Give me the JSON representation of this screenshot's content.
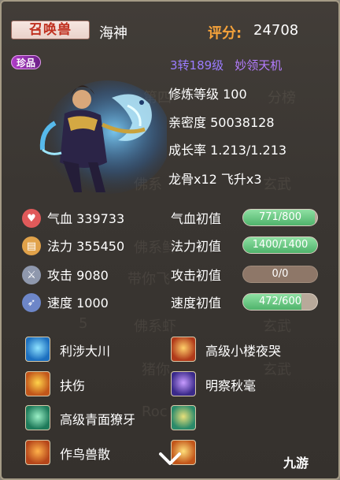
{
  "header": {
    "name_tag": "召唤兽",
    "pet_name": "海神",
    "score_label": "评分:",
    "score_value": "24708"
  },
  "portrait": {
    "rarity": "珍品",
    "reincarnation": "3转189级",
    "title": "妙领天机"
  },
  "info": {
    "cultivation": "修炼等级 100",
    "intimacy": "亲密度 50038128",
    "growth": "成长率 1.213/1.213",
    "items": "龙骨x12   飞升x3"
  },
  "stats": [
    {
      "label": "气血 339733",
      "init_label": "气血初值",
      "bar_text": "771/800",
      "fill": 0.964,
      "icon": "heart-icon",
      "color": "#e05a5a"
    },
    {
      "label": "法力 355450",
      "init_label": "法力初值",
      "bar_text": "1400/1400",
      "fill": 1.0,
      "icon": "scroll-icon",
      "color": "#e1a24a"
    },
    {
      "label": "攻击 9080",
      "init_label": "攻击初值",
      "bar_text": "0/0",
      "fill": 0,
      "icon": "sword-icon",
      "color": "#8f98ad"
    },
    {
      "label": "速度 1000",
      "init_label": "速度初值",
      "bar_text": "472/600",
      "fill": 0.787,
      "icon": "speed-icon",
      "color": "#6d86c8"
    }
  ],
  "skills": [
    {
      "name": "利涉大川",
      "icon": "wave-skill-icon"
    },
    {
      "name": "高级小楼夜哭",
      "icon": "fire-wing-skill-icon"
    },
    {
      "name": "扶伤",
      "icon": "flame-skill-icon"
    },
    {
      "name": "明察秋毫",
      "icon": "eye-skill-icon"
    },
    {
      "name": "高级青面獠牙",
      "icon": "mask-skill-icon"
    },
    {
      "name": "",
      "icon": "crown-skill-icon"
    },
    {
      "name": "作鸟兽散",
      "icon": "bird-skill-icon"
    },
    {
      "name": "",
      "icon": "flame-skill-icon-2"
    }
  ],
  "background_ghost": [
    "第四",
    "分榜",
    "佛系",
    "佛系鲜",
    "带你飞",
    "佛系虾",
    "猪你",
    "玄武",
    "玄武",
    "玄武",
    "Roc",
    "5"
  ],
  "watermark": "九游"
}
